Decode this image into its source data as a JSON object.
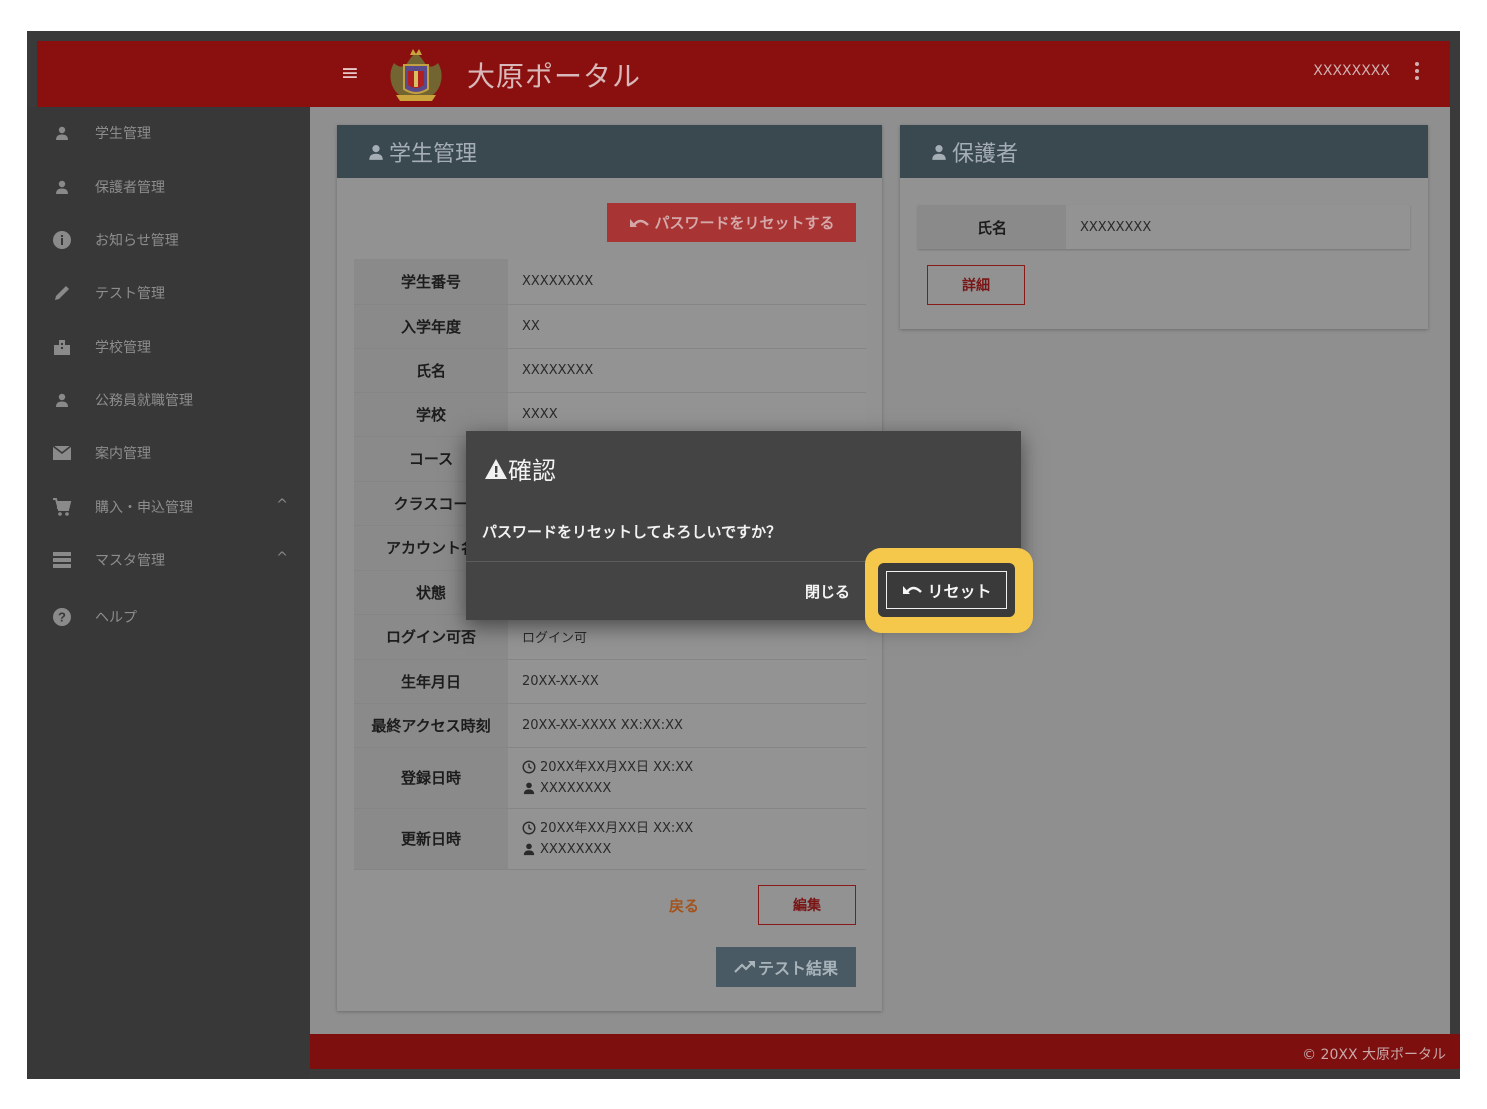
{
  "topbar": {
    "title": "大原ポータル",
    "user": "XXXXXXXX",
    "menu_icon": "menu-icon",
    "more_icon": "more-vert-icon"
  },
  "sidebar": {
    "items": [
      {
        "label": "学生管理",
        "icon": "person-icon"
      },
      {
        "label": "保護者管理",
        "icon": "person-icon"
      },
      {
        "label": "お知らせ管理",
        "icon": "info-icon"
      },
      {
        "label": "テスト管理",
        "icon": "pencil-icon"
      },
      {
        "label": "学校管理",
        "icon": "building-icon"
      },
      {
        "label": "公務員就職管理",
        "icon": "person-icon"
      },
      {
        "label": "案内管理",
        "icon": "mail-icon"
      },
      {
        "label": "購入・申込管理",
        "icon": "cart-icon",
        "expand": "^"
      },
      {
        "label": "マスタ管理",
        "icon": "list-icon",
        "expand": "^"
      },
      {
        "label": "ヘルプ",
        "icon": "help-icon"
      }
    ]
  },
  "student_card": {
    "title": "学生管理",
    "reset_password_label": "パスワードをリセットする",
    "rows": [
      {
        "key": "学生番号",
        "value": "XXXXXXXX"
      },
      {
        "key": "入学年度",
        "value": "XX"
      },
      {
        "key": "氏名",
        "value": "XXXXXXXX"
      },
      {
        "key": "学校",
        "value": "XXXX"
      },
      {
        "key": "コース",
        "value": ""
      },
      {
        "key": "クラスコー",
        "value": ""
      },
      {
        "key": "アカウント名",
        "value": ""
      },
      {
        "key": "状態",
        "value": ""
      },
      {
        "key": "ログイン可否",
        "value": "ログイン可"
      },
      {
        "key": "生年月日",
        "value": "20XX-XX-XX"
      },
      {
        "key": "最終アクセス時刻",
        "value": "20XX-XX-XXXX XX:XX:XX"
      }
    ],
    "created": {
      "key": "登録日時",
      "time": "20XX年XX月XX日 XX:XX",
      "user": "XXXXXXXX"
    },
    "updated": {
      "key": "更新日時",
      "time": "20XX年XX月XX日 XX:XX",
      "user": "XXXXXXXX"
    },
    "back_label": "戻る",
    "edit_label": "編集",
    "test_results_label": "テスト結果"
  },
  "guardian_card": {
    "title": "保護者",
    "name_key": "氏名",
    "name_value": "XXXXXXXX",
    "detail_label": "詳細"
  },
  "dialog": {
    "title": "確認",
    "message": "パスワードをリセットしてよろしいですか？",
    "close_label": "閉じる",
    "reset_label": "リセット"
  },
  "footer": {
    "text": "© 20XX 大原ポータル"
  },
  "colors": {
    "brand": "#8a1010",
    "header_slate": "#3a4850",
    "highlight": "#f5c84c"
  }
}
